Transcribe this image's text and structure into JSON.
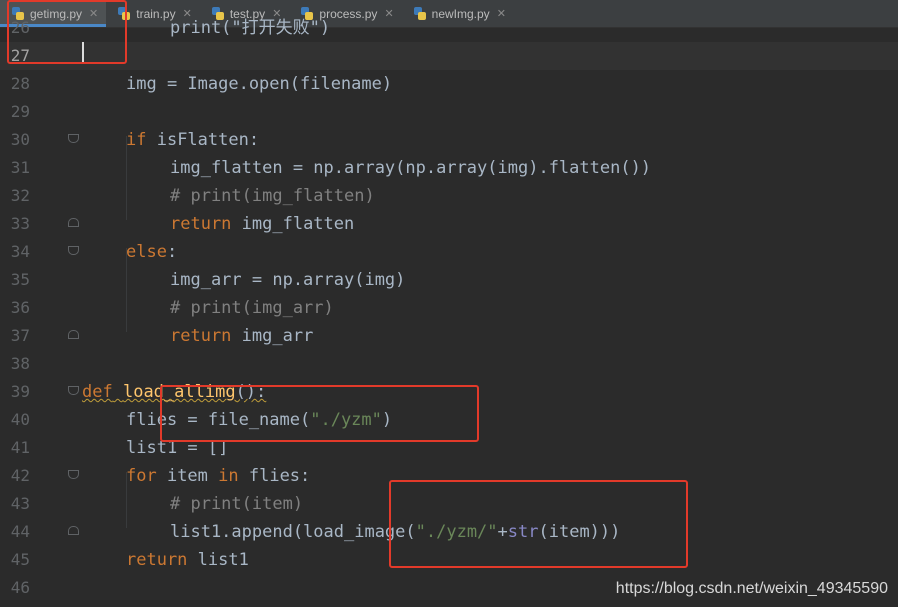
{
  "tabs": [
    {
      "label": "getimg.py",
      "active": true
    },
    {
      "label": "train.py",
      "active": false
    },
    {
      "label": "test.py",
      "active": false
    },
    {
      "label": "process.py",
      "active": false
    },
    {
      "label": "newImg.py",
      "active": false
    }
  ],
  "close_glyph": "✕",
  "editor": {
    "partial_line": {
      "number": "26",
      "text": "print(\"打开失败\")"
    },
    "line_numbers": [
      "27",
      "28",
      "29",
      "30",
      "31",
      "32",
      "33",
      "34",
      "35",
      "36",
      "37",
      "38",
      "39",
      "40",
      "41",
      "42",
      "43",
      "44",
      "45",
      "46"
    ],
    "current_line": "27",
    "code": {
      "l28": {
        "a": "img = Image.open(filename)"
      },
      "l30": {
        "kw": "if",
        "rest": " isFlatten:"
      },
      "l31": {
        "a": "img_flatten = np.array(np.array(img).flatten())"
      },
      "l32": {
        "cm": "# print(img_flatten)"
      },
      "l33": {
        "kw": "return",
        "rest": " img_flatten"
      },
      "l34": {
        "kw": "else",
        "rest": ":"
      },
      "l35": {
        "a": "img_arr = np.array(img)"
      },
      "l36": {
        "cm": "# print(img_arr)"
      },
      "l37": {
        "kw": "return",
        "rest": " img_arr"
      },
      "l39": {
        "kw": "def",
        "sp": " ",
        "fn": "load_allimg",
        "rest": "():"
      },
      "l40": {
        "a": "flies = file_name(",
        "str": "\"./yzm\"",
        "b": ")"
      },
      "l41": {
        "a": "list1 = []"
      },
      "l42": {
        "kw1": "for",
        "mid": " item ",
        "kw2": "in",
        "rest": " flies:"
      },
      "l43": {
        "cm": "# print(item)"
      },
      "l44": {
        "a": "list1.append(load_image(",
        "str": "\"./yzm/\"",
        "plus": "+",
        "bi": "str",
        "b": "(item)))"
      },
      "l45": {
        "kw": "return",
        "rest": " list1"
      }
    }
  },
  "watermark": "https://blog.csdn.net/weixin_49345590",
  "colors": {
    "background": "#2b2b2b",
    "keyword": "#cc7832",
    "function": "#ffc66d",
    "string": "#6a8759",
    "comment": "#808080",
    "annotation_box": "#e23a2a"
  }
}
